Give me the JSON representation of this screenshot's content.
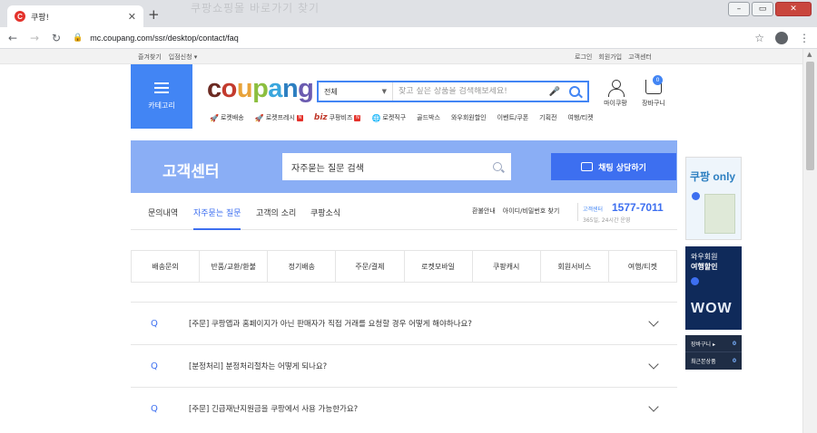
{
  "browser": {
    "tab_title": "쿠팡!",
    "tab_favicon": "C",
    "ghost_title": "쿠팡쇼핑몰 바로가기 찾기",
    "url": "mc.coupang.com/ssr/desktop/contact/faq"
  },
  "topbar": {
    "left": [
      "즐겨찾기",
      "입점신청 ▾"
    ],
    "right": [
      "로그인",
      "회원가입",
      "고객센터"
    ]
  },
  "header": {
    "category_label": "카테고리",
    "logo": [
      "c",
      "o",
      "u",
      "p",
      "a",
      "n",
      "g"
    ],
    "search_category": "전체",
    "search_placeholder": "찾고 싶은 상품을 검색해보세요!",
    "mycoupang": "마이쿠팡",
    "cart": "장바구니",
    "cart_count": "0"
  },
  "quicknav": [
    {
      "icon": "rocket-icon",
      "label": "로켓배송"
    },
    {
      "icon": "rocket-fresh-icon",
      "label": "로켓프레시",
      "badge": "N"
    },
    {
      "icon": "biz-icon",
      "prefix": "biz",
      "label": "쿠팡비즈",
      "badge": "N"
    },
    {
      "icon": "globe-icon",
      "label": "로켓직구"
    },
    {
      "label": "골드박스"
    },
    {
      "label": "와우회원할인"
    },
    {
      "label": "이벤트/쿠폰"
    },
    {
      "label": "기획전"
    },
    {
      "label": "여행/티켓"
    }
  ],
  "cc": {
    "title": "고객센터",
    "search_text": "자주묻는 질문 검색",
    "chat_button": "채팅 상담하기",
    "tabs": [
      "문의내역",
      "자주묻는 질문",
      "고객의 소리",
      "쿠팡소식"
    ],
    "active_tab": 1,
    "right_links": [
      "환불안내",
      "아이디/비밀번호 찾기"
    ],
    "phone_label": "고객센터",
    "phone": "1577-7011",
    "hours": "365일, 24시간 운영"
  },
  "categories": [
    "배송문의",
    "반품/교환/환불",
    "정기배송",
    "주문/결제",
    "로켓모바일",
    "쿠팡캐시",
    "회원서비스",
    "여행/티켓"
  ],
  "faq": [
    {
      "q": "Q",
      "text": "[주문] 쿠팡앱과 홈페이지가 아닌 판매자가 직접 거래를 요청할 경우 어떻게 해야하나요?"
    },
    {
      "q": "Q",
      "text": "[분정처리] 분정처리절차는 어떻게 되나요?"
    },
    {
      "q": "Q",
      "text": "[주문] 긴급재난지원금을 쿠팡에서 사용 가능한가요?"
    }
  ],
  "side": {
    "ad1_title": "쿠팡 only",
    "ad2_title_1": "와우회원",
    "ad2_title_2": "여행할인",
    "ad2_wow": "WOW",
    "mini": [
      {
        "label": "장바구니 ▸",
        "count": "0"
      },
      {
        "label": "최근본상품",
        "count": "0"
      }
    ]
  },
  "colors": {
    "accent": "#4285f4",
    "banner": "#8aaef5",
    "chat_button": "#3d6ff0"
  }
}
